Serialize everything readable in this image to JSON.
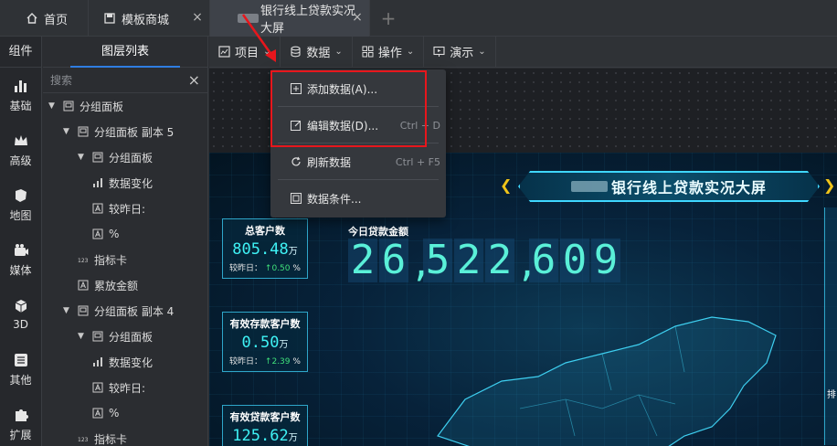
{
  "tabs": {
    "home": "首页",
    "market": "模板商城",
    "active": "银行线上贷款实况大屏",
    "close_glyph": "×",
    "add_glyph": "+"
  },
  "rail": {
    "title": "组件",
    "items": [
      {
        "label": "基础",
        "icon": "bar-chart-icon"
      },
      {
        "label": "高级",
        "icon": "crown-icon"
      },
      {
        "label": "地图",
        "icon": "map-icon"
      },
      {
        "label": "媒体",
        "icon": "camera-icon"
      },
      {
        "label": "3D",
        "icon": "cube-icon"
      },
      {
        "label": "其他",
        "icon": "list-icon"
      },
      {
        "label": "扩展",
        "icon": "puzzle-icon"
      }
    ]
  },
  "layers": {
    "title": "图层列表",
    "search_placeholder": "搜索",
    "tree": [
      {
        "label": "分组面板",
        "level": 0,
        "expanded": true,
        "icon": "group-icon"
      },
      {
        "label": "分组面板 副本 5",
        "level": 1,
        "expanded": true,
        "icon": "group-icon"
      },
      {
        "label": "分组面板",
        "level": 2,
        "expanded": true,
        "icon": "group-icon"
      },
      {
        "label": "数据变化",
        "level": 3,
        "icon": "bar-icon"
      },
      {
        "label": "较昨日:",
        "level": 3,
        "icon": "text-icon"
      },
      {
        "label": "%",
        "level": 3,
        "icon": "text-icon"
      },
      {
        "label": "指标卡",
        "level": 2,
        "icon": "number-icon"
      },
      {
        "label": "累放金额",
        "level": 2,
        "icon": "text-icon"
      },
      {
        "label": "分组面板 副本 4",
        "level": 1,
        "expanded": true,
        "icon": "group-icon"
      },
      {
        "label": "分组面板",
        "level": 2,
        "expanded": true,
        "icon": "group-icon"
      },
      {
        "label": "数据变化",
        "level": 3,
        "icon": "bar-icon"
      },
      {
        "label": "较昨日:",
        "level": 3,
        "icon": "text-icon"
      },
      {
        "label": "%",
        "level": 3,
        "icon": "text-icon"
      },
      {
        "label": "指标卡",
        "level": 2,
        "icon": "number-icon"
      }
    ]
  },
  "toolbar": {
    "project": "项目",
    "data": "数据",
    "operate": "操作",
    "demo": "演示"
  },
  "menu": {
    "items": [
      {
        "label": "添加数据(A)...",
        "shortcut": "",
        "icon": "add-icon"
      },
      {
        "label": "编辑数据(D)...",
        "shortcut": "Ctrl + D",
        "icon": "edit-icon"
      },
      {
        "label": "刷新数据",
        "shortcut": "Ctrl + F5",
        "icon": "refresh-icon"
      },
      {
        "label": "数据条件...",
        "shortcut": "",
        "icon": "condition-icon"
      }
    ]
  },
  "dashboard": {
    "banner_title": "银行线上贷款实况大屏",
    "kpis": [
      {
        "title": "总客户数",
        "value": "805.48",
        "unit": "万",
        "compare_label": "较昨日：",
        "arrow": "↑",
        "change": "0.50",
        "pct": "%"
      },
      {
        "title": "有效存款客户数",
        "value": "0.50",
        "unit": "万",
        "compare_label": "较昨日：",
        "arrow": "↑",
        "change": "2.39",
        "pct": "%"
      },
      {
        "title": "有效贷款客户数",
        "value": "125.62",
        "unit": "万"
      }
    ],
    "total_label": "今日贷款金额",
    "total_digits": [
      "2",
      "6",
      ",",
      "5",
      "2",
      "2",
      ",",
      "6",
      "0",
      "9"
    ],
    "right_label": "排"
  },
  "colors": {
    "accent": "#2f7de1",
    "highlight": "#e8161c",
    "kpi_value": "#3ff2f5",
    "digit": "#5af0d8",
    "up": "#3fe07a"
  }
}
